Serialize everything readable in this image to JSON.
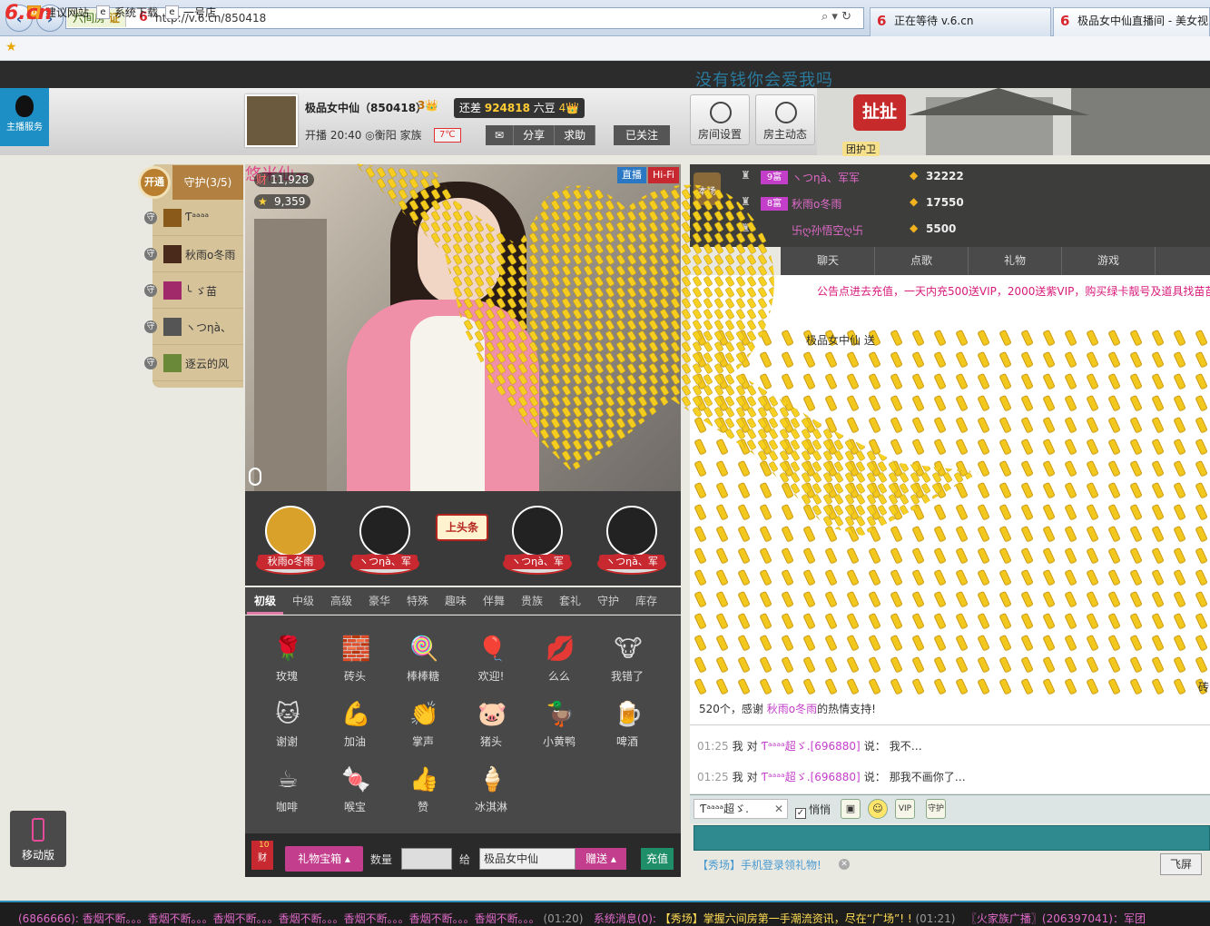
{
  "browser": {
    "site_tag": "六间房",
    "cert": "证",
    "url": "http://v.6.cn/850418",
    "tabs": [
      {
        "label": "正在等待 v.6.cn"
      },
      {
        "label": "极品女中仙直播间 - 美女视..."
      }
    ],
    "favorites": [
      "建议网站",
      "系统下载",
      "一号店"
    ]
  },
  "site": {
    "logo": "6.cn",
    "marquee_title": "没有钱你会爱我吗",
    "host_service": "主播服务"
  },
  "host": {
    "name": "极品女中仙（850418）",
    "level": "3",
    "need_label": "还差",
    "need_value": "924818",
    "need_unit": "六豆",
    "need_level": "4",
    "start_label": "开播 20:40",
    "location": "衡阳",
    "family_label": "家族",
    "temp": "7℃",
    "actions": [
      "分享",
      "求助"
    ],
    "follow_label": "已关注"
  },
  "tools": {
    "room_settings": "房间设置",
    "host_news": "房主动态",
    "pull": "扯扯",
    "guard_team": "团护卫"
  },
  "guards": {
    "open_label": "开通",
    "title": "守护(3/5)",
    "items": [
      {
        "badge": "守",
        "name": "Ƭᵃᵃᵃᵃ",
        "color": "#8a5a1a"
      },
      {
        "badge": "守",
        "name": "秋雨o冬雨",
        "color": "#4a2a1a"
      },
      {
        "badge": "守",
        "name": "╰ ゞ苗",
        "color": "#a02a6a"
      },
      {
        "badge": "守",
        "name": "ヽつηà、",
        "color": "#555"
      },
      {
        "badge": "守",
        "name": "逐云的风",
        "color": "#6a8a3a"
      }
    ]
  },
  "video": {
    "title": "悠米仙~",
    "wealth_count": "11,928",
    "fans_count": "9,359",
    "live_label": "直播",
    "hifi_label": "Hi-Fi"
  },
  "fans": [
    {
      "name": "秋雨o冬雨"
    },
    {
      "name": "ヽつηà、军"
    },
    {
      "name": "ヽつηà、军"
    },
    {
      "name": "ヽつηà、军"
    }
  ],
  "headline_label": "上头条",
  "gift_tabs": [
    "初级",
    "中级",
    "高级",
    "豪华",
    "特殊",
    "趣味",
    "伴舞",
    "贵族",
    "套礼",
    "守护",
    "库存"
  ],
  "gifts": [
    {
      "label": "玫瑰",
      "icon": "rose-icon",
      "glyph": "🌹"
    },
    {
      "label": "砖头",
      "icon": "brick-icon",
      "glyph": "🧱"
    },
    {
      "label": "棒棒糖",
      "icon": "lollipop-icon",
      "glyph": "🍭"
    },
    {
      "label": "欢迎!",
      "icon": "balloon-icon",
      "glyph": "🎈"
    },
    {
      "label": "么么",
      "icon": "kiss-icon",
      "glyph": "💋"
    },
    {
      "label": "我错了",
      "icon": "cow-icon",
      "glyph": "🐮"
    },
    {
      "label": "谢谢",
      "icon": "cat-icon",
      "glyph": "🐱"
    },
    {
      "label": "加油",
      "icon": "cheer-icon",
      "glyph": "💪"
    },
    {
      "label": "掌声",
      "icon": "clap-icon",
      "glyph": "👏"
    },
    {
      "label": "猪头",
      "icon": "pig-icon",
      "glyph": "🐷"
    },
    {
      "label": "小黄鸭",
      "icon": "duck-icon",
      "glyph": "🦆"
    },
    {
      "label": "啤酒",
      "icon": "beer-icon",
      "glyph": "🍺"
    },
    {
      "label": "咖啡",
      "icon": "coffee-icon",
      "glyph": "☕"
    },
    {
      "label": "喉宝",
      "icon": "candy-icon",
      "glyph": "🍬"
    },
    {
      "label": "赞",
      "icon": "thumb-icon",
      "glyph": "👍"
    },
    {
      "label": "冰淇淋",
      "icon": "icecream-icon",
      "glyph": "🍦"
    }
  ],
  "send_bar": {
    "wealth_num": "10",
    "wealth_label": "财",
    "gift_box": "礼物宝箱",
    "qty_label": "数量",
    "to_label": "给",
    "to_value": "极品女中仙",
    "send_label": "赠送",
    "recharge_label": "充值"
  },
  "rank": {
    "local_label": "本场",
    "rows": [
      {
        "lv": "9富",
        "name": "ヽつηà、军军",
        "score": "32222"
      },
      {
        "lv": "8富",
        "name": "秋雨o冬雨",
        "score": "17550"
      },
      {
        "lv": "",
        "name": "卐ღ孙悟空ღ卐",
        "score": "5500"
      }
    ]
  },
  "chat_tabs": [
    "聊天",
    "点歌",
    "礼物",
    "游戏"
  ],
  "chat": {
    "notice": "公告点进去充值，一天内充500送VIP，2000送紫VIP，购买绿卡靓号及道具找苗苗",
    "gift_msg": "极品女中仙 送",
    "thanks_prefix": "520个，感谢",
    "thanks_user": "秋雨o冬雨",
    "thanks_suffix": "的热情支持!",
    "brick_char": "砖",
    "log": [
      {
        "time": "01:25",
        "me": "我",
        "to": "对",
        "user": "Ƭᵃᵃᵃᵃ超ゞ.[696880]",
        "said": "说：",
        "text": "我不…"
      },
      {
        "time": "01:25",
        "me": "我",
        "to": "对",
        "user": "Ƭᵃᵃᵃᵃ超ゞ.[696880]",
        "said": "说：",
        "text": "那我不画你了…"
      }
    ],
    "to_user": "Ƭᵃᵃᵃᵃ超ゞ.",
    "whisper": "悄悄",
    "promo": "【秀场】手机登录领礼物!",
    "fly_btn": "飞屏"
  },
  "mobile_label": "移动版",
  "ticker": {
    "a": "(6866666): 香烟不断。。。香烟不断。。。香烟不断。。。香烟不断。。。香烟不断。。。香烟不断。。。香烟不断。。。",
    "t1": "(01:20)",
    "sys": "系统消息(0):",
    "c": "【秀场】掌握六间房第一手潮流资讯，尽在“广场”! !",
    "t2": "(01:21)",
    "d": "〖火家族广播〗(206397041)：军团"
  },
  "colors": {
    "accent_pink": "#c33e8c",
    "brand_red": "#d8262d",
    "gift_panel": "#484848"
  }
}
